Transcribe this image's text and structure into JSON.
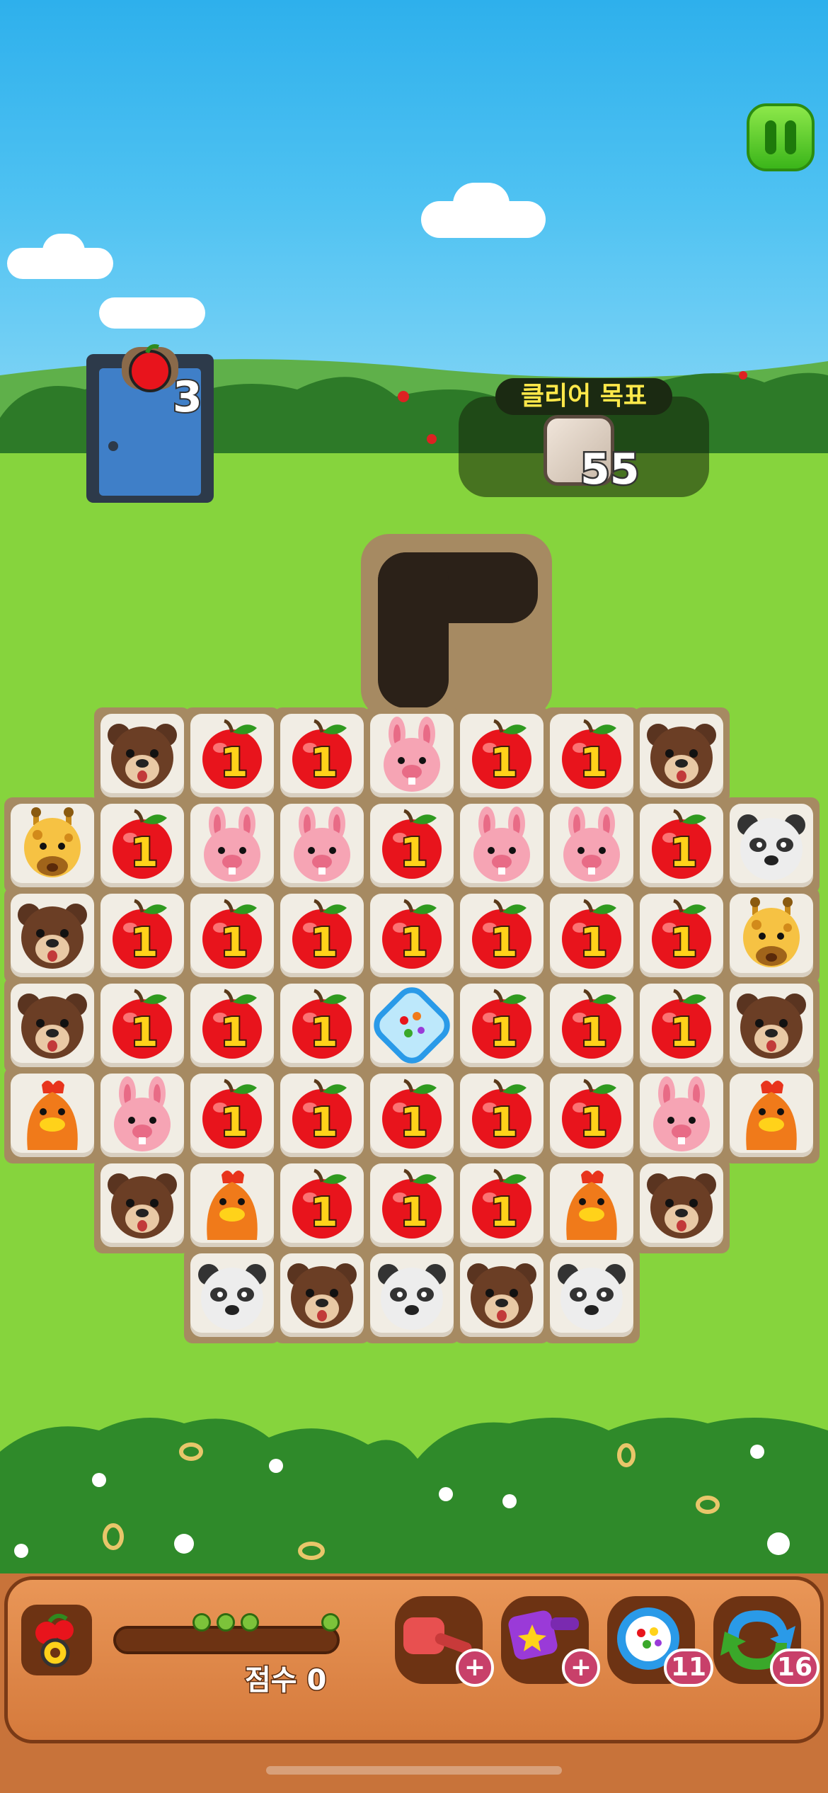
{
  "hud": {
    "moves_left": "3",
    "goal_title": "클리어 목표",
    "goal_count": "55",
    "score_label": "점수 0",
    "pause_icon": "pause-icon"
  },
  "boosters": [
    {
      "icon": "hammer-icon",
      "badge": "+"
    },
    {
      "icon": "magic-hammer-icon",
      "badge": "+"
    },
    {
      "icon": "color-bomb-icon",
      "badge": "11"
    },
    {
      "icon": "shuffle-icon",
      "badge": "16"
    }
  ],
  "board": {
    "apple_label": "1",
    "rows": [
      [
        "",
        "bear",
        "apple",
        "apple",
        "rabbit",
        "apple",
        "apple",
        "bear",
        ""
      ],
      [
        "giraffe",
        "apple",
        "rabbit",
        "rabbit",
        "apple",
        "rabbit",
        "rabbit",
        "apple",
        "panda"
      ],
      [
        "bear",
        "apple",
        "apple",
        "apple",
        "apple",
        "apple",
        "apple",
        "apple",
        "giraffe"
      ],
      [
        "bear",
        "apple",
        "apple",
        "apple",
        "special",
        "apple",
        "apple",
        "apple",
        "bear"
      ],
      [
        "chicken",
        "rabbit",
        "apple",
        "apple",
        "apple",
        "apple",
        "apple",
        "rabbit",
        "chicken"
      ],
      [
        "",
        "bear",
        "chicken",
        "apple",
        "apple",
        "apple",
        "chicken",
        "bear",
        ""
      ],
      [
        "",
        "",
        "panda",
        "bear",
        "panda",
        "bear",
        "panda",
        "",
        ""
      ]
    ]
  },
  "colors": {
    "sky": "#2eb0ec",
    "grass": "#86d43d",
    "wood": "#d57a3c",
    "apple": "#e8141c",
    "gold": "#ffd21a"
  }
}
